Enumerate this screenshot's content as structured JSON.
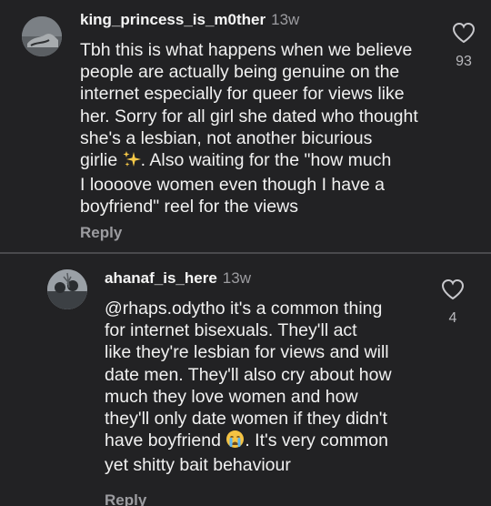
{
  "comments": [
    {
      "username": "king_princess_is_m0ther",
      "time": "13w",
      "text_before": "Tbh this is what happens when we believe\npeople are actually being genuine on the\ninternet especially for queer for views like\nher. Sorry for all girl she dated who thought\nshe's a lesbian, not another bicurious\ngirlie ",
      "emoji": "sparkles",
      "text_after": ". Also waiting for the \"how much\nI loooove women even though I have a\nboyfriend\" reel for the views",
      "reply_label": "Reply",
      "like_icon": "heart-outline",
      "like_count": "93"
    },
    {
      "username": "ahanaf_is_here",
      "time": "13w",
      "text_before": "@rhaps.odytho it's a common thing\nfor internet bisexuals. They'll act\nlike they're lesbian for views and will\ndate men. They'll also cry about how\nmuch they love women and how\nthey'll only date women if they didn't\nhave boyfriend ",
      "emoji": "crying-face",
      "text_after": ". It's very common\nyet shitty bait behaviour",
      "reply_label": "Reply",
      "like_icon": "heart-outline",
      "like_count": "4"
    }
  ]
}
